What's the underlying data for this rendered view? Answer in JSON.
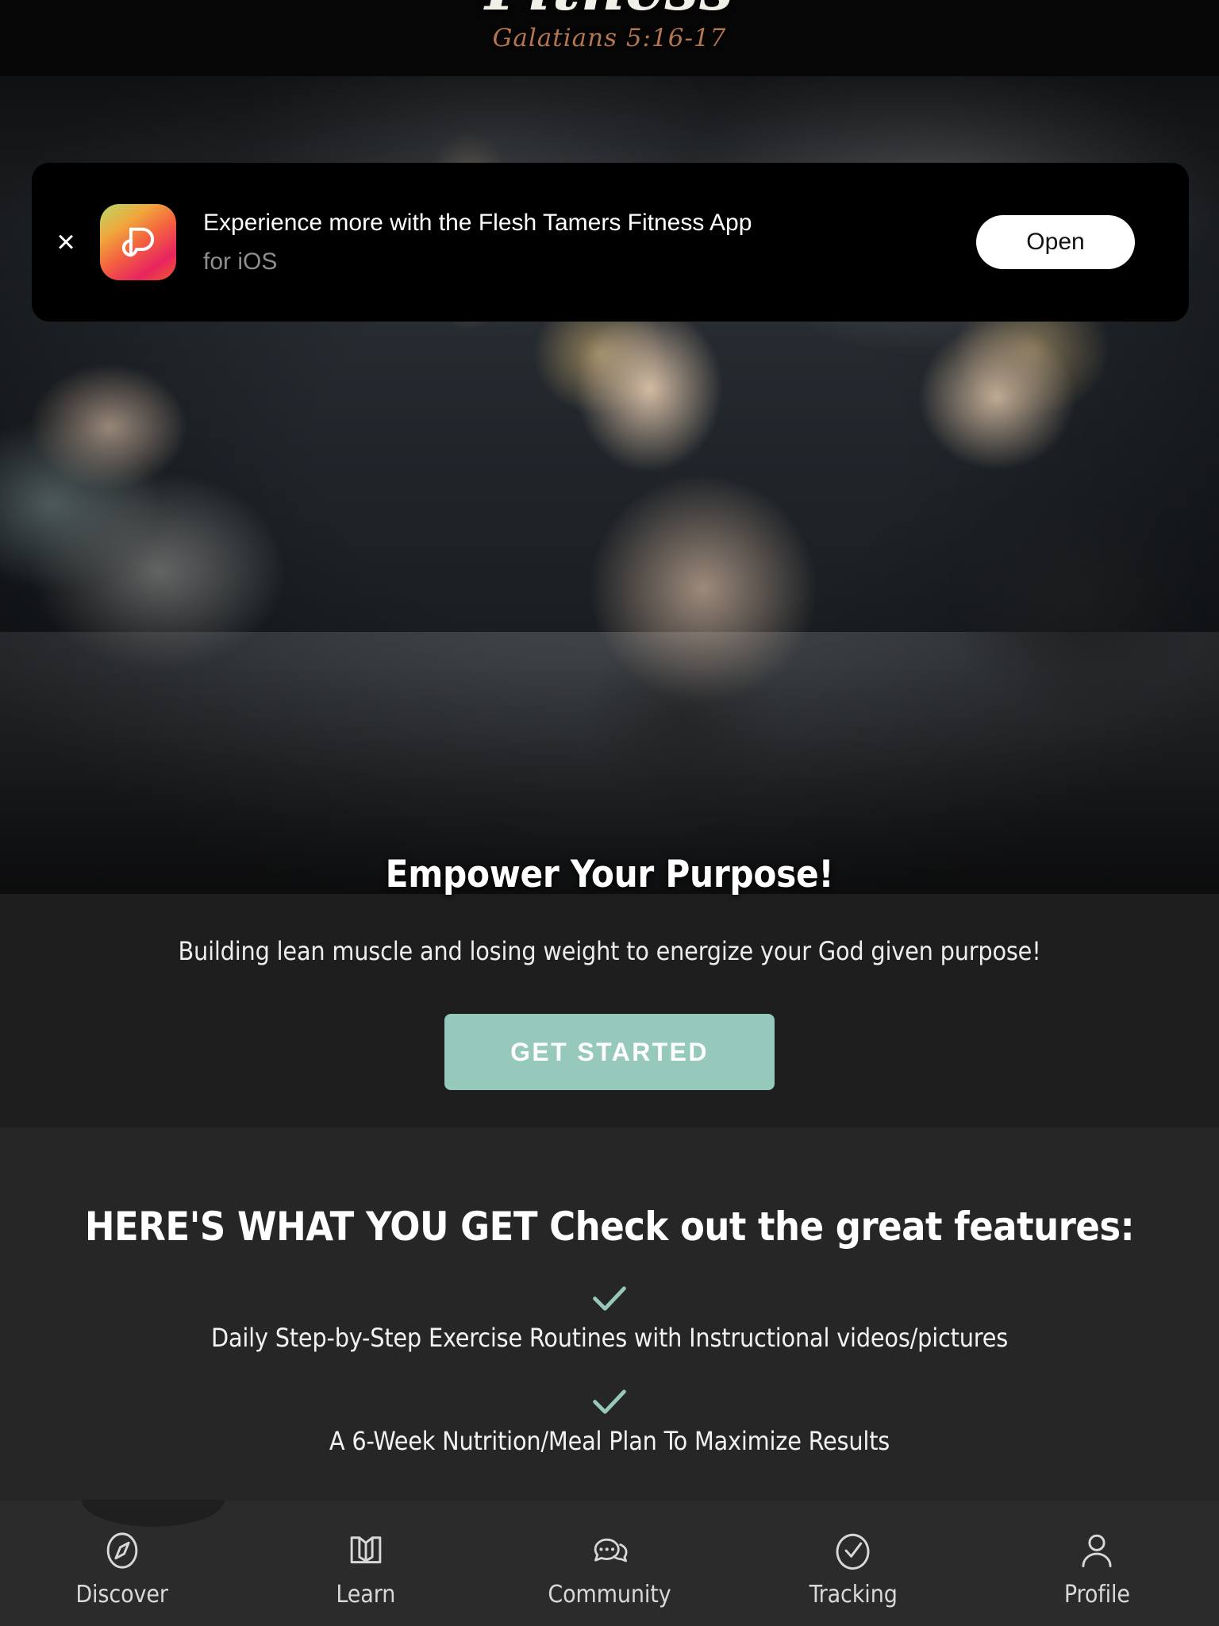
{
  "header": {
    "logo_script": "Fitness",
    "logo_verse": "Galatians 5:16-17"
  },
  "app_banner": {
    "close_label": "×",
    "icon_name": "flesh-tamers-app-icon",
    "title": "Experience more with the Flesh Tamers Fitness App",
    "subtitle": "for iOS",
    "open_label": "Open",
    "background_color": "#000000",
    "open_button_color": "#ffffff"
  },
  "hero": {
    "headline": "Empower Your Purpose!",
    "subheadline": "Building lean muscle and losing weight to energize your God given purpose!",
    "cta_label": "GET STARTED",
    "cta_color": "#96c9bc"
  },
  "features": {
    "heading": "HERE'S WHAT YOU GET Check out the great features:",
    "check_color": "#96c9bc",
    "items": [
      {
        "label": "Daily Step-by-Step Exercise Routines with Instructional videos/pictures"
      },
      {
        "label": "A 6-Week Nutrition/Meal Plan To Maximize Results"
      }
    ]
  },
  "bottom_nav": {
    "active_index": 0,
    "items": [
      {
        "label": "Discover",
        "icon": "compass-icon"
      },
      {
        "label": "Learn",
        "icon": "book-icon"
      },
      {
        "label": "Community",
        "icon": "chat-bubbles-icon"
      },
      {
        "label": "Tracking",
        "icon": "check-circle-icon"
      },
      {
        "label": "Profile",
        "icon": "person-icon"
      }
    ]
  }
}
